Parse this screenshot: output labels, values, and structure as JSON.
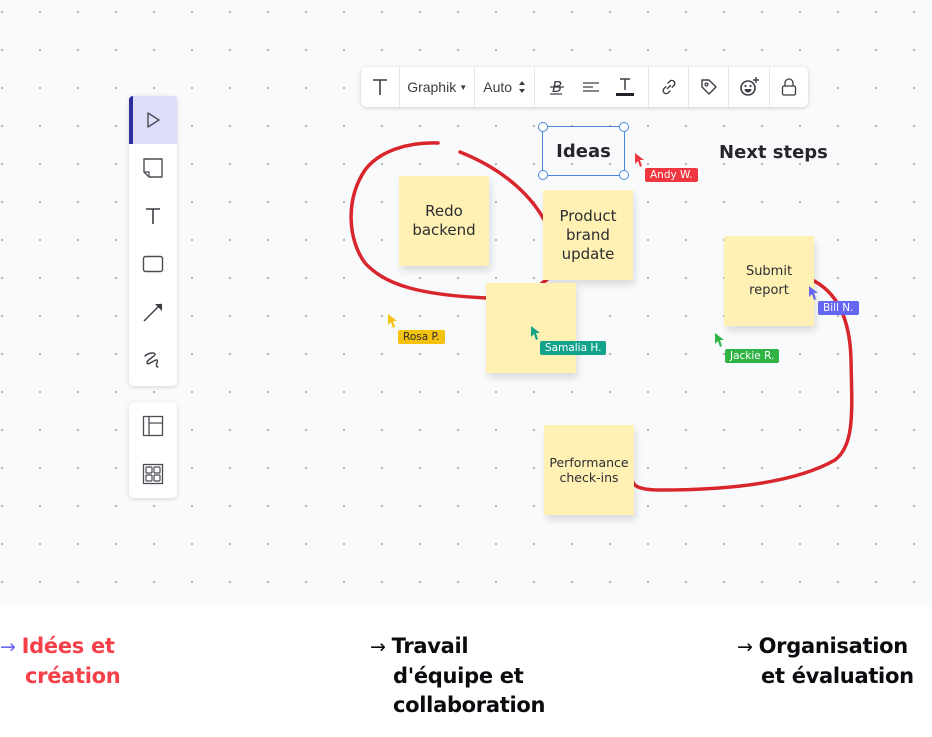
{
  "toolbar": {
    "items": [
      {
        "name": "text-style",
        "icon": "text-icon"
      },
      {
        "name": "font-family",
        "label": "Graphik",
        "icon": "caret-down-icon"
      },
      {
        "name": "font-size",
        "label": "Auto",
        "icon": "stepper-icon"
      },
      {
        "name": "bold",
        "icon": "bold-strikethrough-icon"
      },
      {
        "name": "align",
        "icon": "align-left-icon"
      },
      {
        "name": "text-color",
        "icon": "text-color-icon"
      },
      {
        "name": "link",
        "icon": "link-icon"
      },
      {
        "name": "tag",
        "icon": "tag-icon"
      },
      {
        "name": "reaction",
        "icon": "emoji-add-icon"
      },
      {
        "name": "lock",
        "icon": "lock-icon"
      }
    ]
  },
  "sidebar": {
    "tools": [
      {
        "name": "select",
        "icon": "pointer-icon",
        "active": true
      },
      {
        "name": "sticky-note",
        "icon": "sticky-note-icon"
      },
      {
        "name": "text",
        "icon": "text-icon"
      },
      {
        "name": "shape",
        "icon": "rectangle-icon"
      },
      {
        "name": "line",
        "icon": "arrow-icon"
      },
      {
        "name": "draw",
        "icon": "freehand-icon"
      }
    ],
    "extras": [
      {
        "name": "frames",
        "icon": "layout-icon"
      },
      {
        "name": "templates",
        "icon": "grid-icon"
      }
    ]
  },
  "canvas": {
    "labels": {
      "ideas": "Ideas",
      "next_steps": "Next steps"
    },
    "stickies": [
      {
        "id": "redo",
        "text": "Redo backend"
      },
      {
        "id": "brand",
        "text": "Product brand update"
      },
      {
        "id": "blank",
        "text": ""
      },
      {
        "id": "submit",
        "text": "Submit report"
      },
      {
        "id": "perf",
        "text": "Performance check-ins"
      }
    ],
    "collaborators": [
      {
        "name": "Andy W.",
        "color": "#f0363f"
      },
      {
        "name": "Rosa P.",
        "color": "#f4c20d"
      },
      {
        "name": "Samalia H.",
        "color": "#12a38a"
      },
      {
        "name": "Jackie R.",
        "color": "#2fb344"
      },
      {
        "name": "Bill N.",
        "color": "#6465f0"
      }
    ],
    "ink_color": "#d9262c"
  },
  "footer": {
    "items": [
      {
        "line1": "Idées et",
        "line2": "création",
        "line3": "",
        "color": "#f5404a",
        "arrow_color": "#6969f2",
        "active": true
      },
      {
        "line1": "Travail",
        "line2": "d'équipe et",
        "line3": "collaboration",
        "color": "#0b0b0f",
        "arrow_color": "#0b0b0f"
      },
      {
        "line1": "Organisation",
        "line2": "et évaluation",
        "line3": "",
        "color": "#0b0b0f",
        "arrow_color": "#0b0b0f"
      }
    ],
    "arrow": "→"
  }
}
